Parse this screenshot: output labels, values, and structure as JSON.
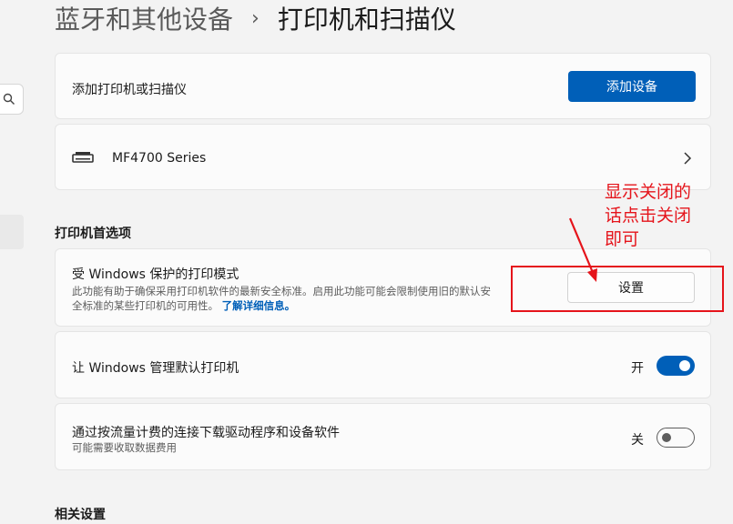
{
  "breadcrumb": {
    "parent": "蓝牙和其他设备",
    "separator": "›",
    "current": "打印机和扫描仪"
  },
  "add_device_card": {
    "label": "添加打印机或扫描仪",
    "button_label": "添加设备"
  },
  "printer_card": {
    "name": "MF4700 Series"
  },
  "printer_prefs": {
    "heading": "打印机首选项",
    "protected_mode": {
      "title": "受 Windows 保护的打印模式",
      "description_line1": "此功能有助于确保采用打印机软件的最新安全标准。启用此功能可能会限制使用旧的默认安",
      "description_line2": "全标准的某些打印机的可用性。",
      "link": "了解详细信息。",
      "button_label": "设置"
    },
    "manage_default": {
      "title": "让 Windows 管理默认打印机",
      "state_label": "开",
      "state": true
    },
    "metered_download": {
      "title": "通过按流量计费的连接下载驱动程序和设备软件",
      "description": "可能需要收取数据费用",
      "state_label": "关",
      "state": false
    }
  },
  "related_settings": {
    "heading": "相关设置"
  },
  "annotation": {
    "line1": "显示关闭的",
    "line2": "话点击关闭",
    "line3": "即可",
    "color": "#e5141b"
  },
  "colors": {
    "accent": "#005fb8",
    "background": "#f3f3f3",
    "card": "#fbfbfb"
  }
}
